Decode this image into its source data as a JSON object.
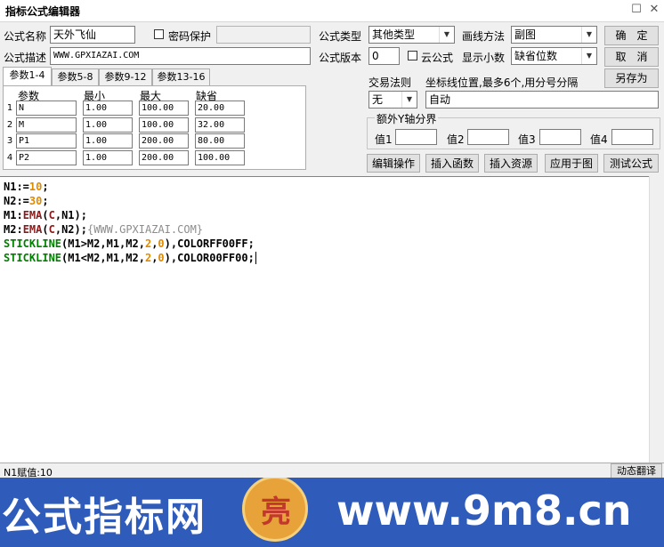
{
  "window": {
    "title": "指标公式编辑器",
    "restore_glyph": "☐",
    "close_glyph": "✕"
  },
  "form": {
    "name_label": "公式名称",
    "name_value": "天外飞仙",
    "password_label": "密码保护",
    "desc_label": "公式描述",
    "desc_value": "WWW.GPXIAZAI.COM",
    "type_label": "公式类型",
    "type_value": "其他类型",
    "draw_label": "画线方法",
    "draw_value": "副图",
    "version_label": "公式版本",
    "version_value": "0",
    "cloud_label": "云公式",
    "decimals_label": "显示小数",
    "decimals_value": "缺省位数"
  },
  "buttons": {
    "ok": "确　定",
    "cancel": "取　消",
    "save_as": "另存为",
    "edit_ops": "编辑操作",
    "insert_func": "插入函数",
    "insert_res": "插入资源",
    "apply_chart": "应用于图",
    "test": "测试公式"
  },
  "tabs": [
    "参数1-4",
    "参数5-8",
    "参数9-12",
    "参数13-16"
  ],
  "params": {
    "headers": [
      "参数",
      "最小",
      "最大",
      "缺省"
    ],
    "rows": [
      {
        "no": "1",
        "name": "N",
        "min": "1.00",
        "max": "100.00",
        "def": "20.00"
      },
      {
        "no": "2",
        "name": "M",
        "min": "1.00",
        "max": "100.00",
        "def": "32.00"
      },
      {
        "no": "3",
        "name": "P1",
        "min": "1.00",
        "max": "200.00",
        "def": "80.00"
      },
      {
        "no": "4",
        "name": "P2",
        "min": "1.00",
        "max": "200.00",
        "def": "100.00"
      }
    ]
  },
  "trade": {
    "rule_label": "交易法则",
    "rule_value": "无",
    "coord_label": "坐标线位置,最多6个,用分号分隔",
    "coord_value": "自动"
  },
  "yaxis": {
    "title": "额外Y轴分界",
    "labels": [
      "值1",
      "值2",
      "值3",
      "值4"
    ]
  },
  "code": {
    "l1_a": "N1:=",
    "l1_b": "10",
    "l1_c": ";",
    "l2_a": "N2:=",
    "l2_b": "30",
    "l2_c": ";",
    "l3_a": "M1:",
    "l3_fn": "EMA",
    "l3_b": "(",
    "l3_c": "C",
    "l3_d": ",N1);",
    "l4_a": "M2:",
    "l4_fn": "EMA",
    "l4_b": "(",
    "l4_c": "C",
    "l4_d": ",N2);",
    "l4_cmt": "{WWW.GPXIAZAI.COM}",
    "l5_fn": "STICKLINE",
    "l5_a": "(M1>M2,M1,M2,",
    "l5_n1": "2",
    "l5_b": ",",
    "l5_n2": "0",
    "l5_c": "),COLORFF00FF;",
    "l6_fn": "STICKLINE",
    "l6_a": "(M1<M2,M1,M2,",
    "l6_n1": "2",
    "l6_b": ",",
    "l6_n2": "0",
    "l6_c": "),COLOR00FF00;"
  },
  "status": {
    "text": "N1赋值:10",
    "translate_btn": "动态翻译"
  },
  "banner": {
    "left_text": "公式指标网",
    "right_text": "www.9m8.cn",
    "logo_char": "亮"
  }
}
